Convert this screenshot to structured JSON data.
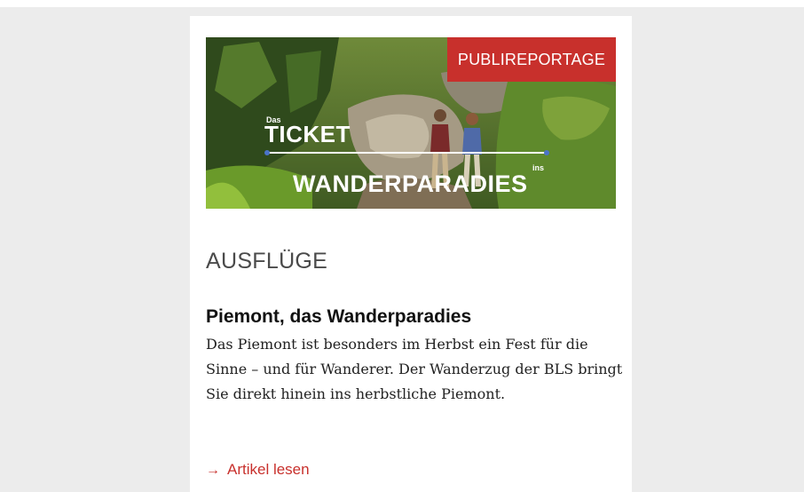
{
  "card": {
    "badge": "PUBLIREPORTAGE",
    "hero_logo": {
      "das": "Das",
      "ticket": "TICKET",
      "ins": "ins",
      "wanderparadies": "WANDERPARADIES"
    },
    "category": "AUSFLÜGE",
    "title": "Piemont, das Wanderparadies",
    "teaser": "Das Piemont ist besonders im Herbst ein Fest für die Sinne – und für Wanderer. Der Wanderzug der BLS bringt Sie direkt hinein ins herbstliche Piemont.",
    "read_more": "Artikel lesen",
    "read_more_icon": "arrow-right-icon"
  },
  "colors": {
    "accent": "#c8302c",
    "page_background": "#ececec",
    "card_background": "#ffffff"
  }
}
